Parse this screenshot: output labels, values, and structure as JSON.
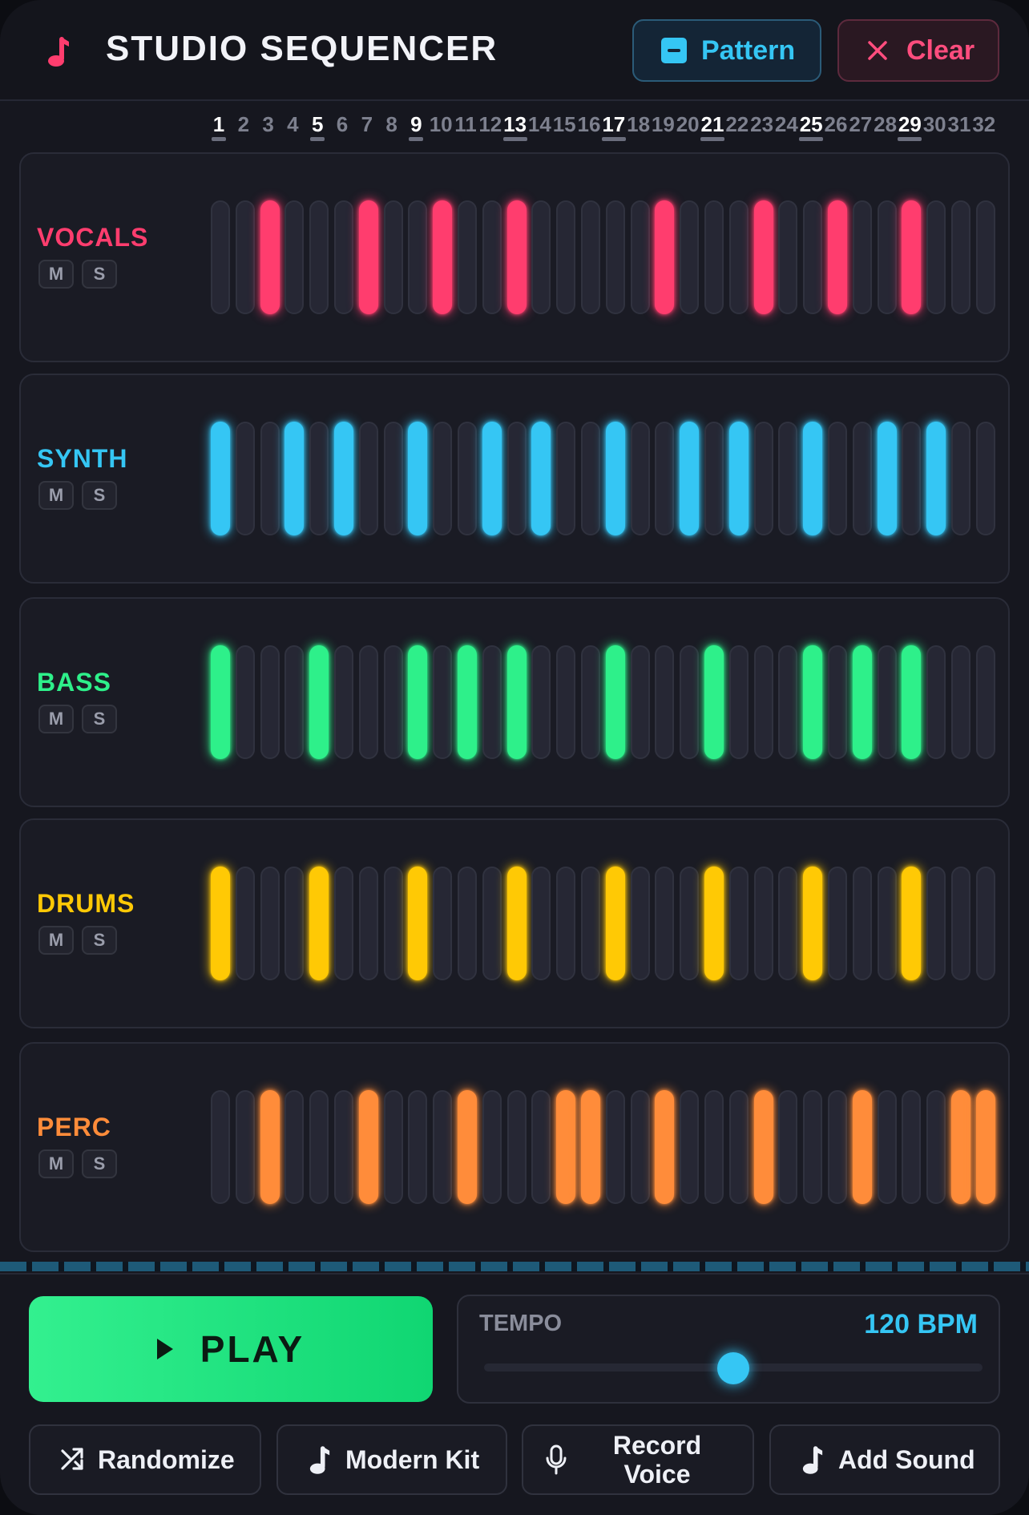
{
  "header": {
    "title": "STUDIO SEQUENCER",
    "pattern_label": "Pattern",
    "clear_label": "Clear"
  },
  "steps": [
    "1",
    "2",
    "3",
    "4",
    "5",
    "6",
    "7",
    "8",
    "9",
    "10",
    "11",
    "12",
    "13",
    "14",
    "15",
    "16",
    "17",
    "18",
    "19",
    "20",
    "21",
    "22",
    "23",
    "24",
    "25",
    "26",
    "27",
    "28",
    "29",
    "30",
    "31",
    "32"
  ],
  "beat_steps": [
    1,
    5,
    9,
    13,
    17,
    21,
    25,
    29
  ],
  "tracks": [
    {
      "name": "VOCALS",
      "color": "#ff3d6e",
      "mute_label": "M",
      "solo_label": "S",
      "active_steps": [
        3,
        7,
        10,
        13,
        19,
        23,
        26,
        29
      ]
    },
    {
      "name": "SYNTH",
      "color": "#35c6f4",
      "mute_label": "M",
      "solo_label": "S",
      "active_steps": [
        1,
        4,
        6,
        9,
        12,
        14,
        17,
        20,
        22,
        25,
        28,
        30
      ]
    },
    {
      "name": "BASS",
      "color": "#2ef08a",
      "mute_label": "M",
      "solo_label": "S",
      "active_steps": [
        1,
        5,
        9,
        11,
        13,
        17,
        21,
        25,
        27,
        29
      ]
    },
    {
      "name": "DRUMS",
      "color": "#ffc905",
      "mute_label": "M",
      "solo_label": "S",
      "active_steps": [
        1,
        5,
        9,
        13,
        17,
        21,
        25,
        29
      ]
    },
    {
      "name": "PERC",
      "color": "#ff8c3a",
      "mute_label": "M",
      "solo_label": "S",
      "active_steps": [
        3,
        7,
        11,
        15,
        16,
        19,
        23,
        27,
        31,
        32
      ]
    }
  ],
  "transport": {
    "play_label": "PLAY",
    "tempo_label": "TEMPO",
    "tempo_value": "120 BPM",
    "tempo_position": 0.5
  },
  "actions": {
    "randomize": "Randomize",
    "modern_kit": "Modern Kit",
    "record_voice_line1": "Record",
    "record_voice_line2": "Voice",
    "add_sound": "Add Sound"
  },
  "icons": {
    "logo": "music-note-icon",
    "pattern": "pattern-icon",
    "clear": "close-icon",
    "play": "play-icon",
    "randomize": "shuffle-icon",
    "modern_kit": "music-note-icon",
    "record_voice": "microphone-icon",
    "add_sound": "music-note-icon"
  }
}
